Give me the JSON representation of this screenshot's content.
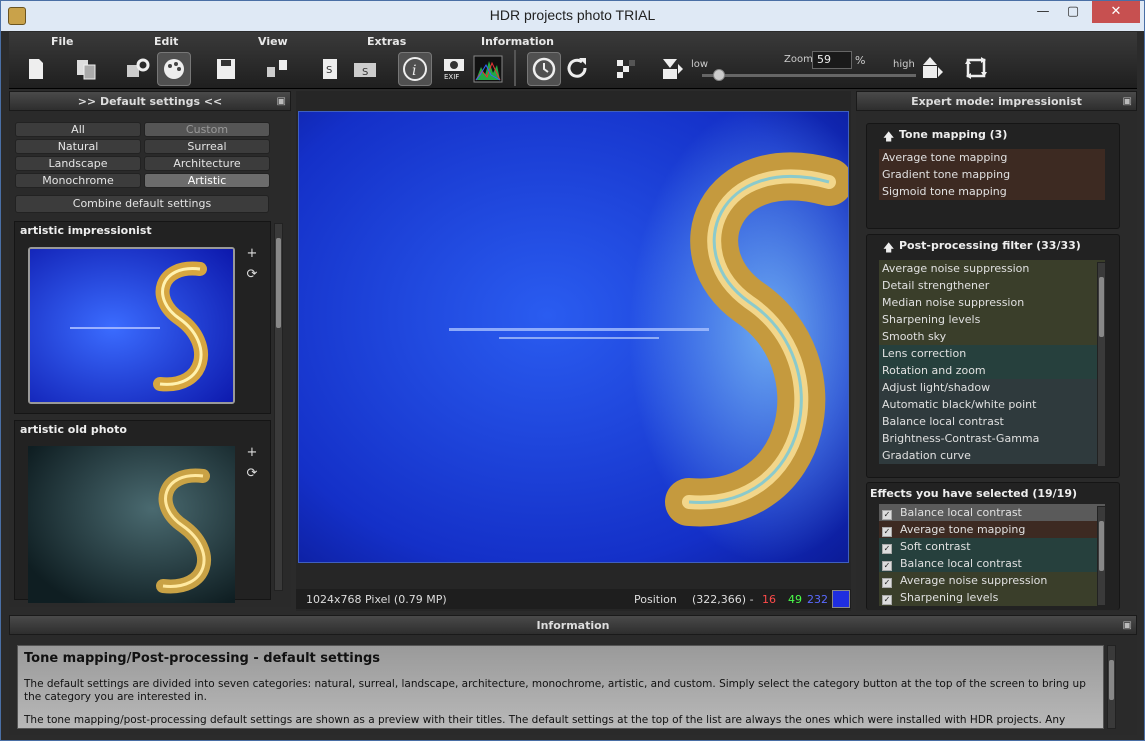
{
  "window": {
    "title": "HDR projects photo  TRIAL",
    "minimize": "—",
    "maximize": "▢",
    "close": "✕"
  },
  "menu": {
    "file": "File",
    "edit": "Edit",
    "view": "View",
    "extras": "Extras",
    "information": "Information"
  },
  "zoom": {
    "label": "Zoom",
    "value": "59",
    "unit": "%",
    "low": "low",
    "high": "high",
    "level": 0.05
  },
  "left_panel": {
    "header": ">> Default settings <<",
    "categories": [
      "All",
      "Custom",
      "Natural",
      "Surreal",
      "Landscape",
      "Architecture",
      "Monochrome",
      "Artistic"
    ],
    "combine": "Combine default settings",
    "presets": [
      {
        "title": "artistic impressionist"
      },
      {
        "title": "artistic old photo"
      }
    ]
  },
  "center": {
    "status_size": "1024x768 Pixel (0.79 MP)",
    "position_label": "Position",
    "position_value": "(322,366) -",
    "r": "16",
    "g": "49",
    "b": "232",
    "swatch_color": "#1f2ee0"
  },
  "right_panel": {
    "header": "Expert mode: impressionist",
    "tone_mapping": {
      "title": "Tone mapping (3)",
      "items": [
        "Average tone mapping",
        "Gradient tone mapping",
        "Sigmoid tone mapping"
      ]
    },
    "post_processing": {
      "title": "Post-processing filter (33/33)",
      "items": [
        "Average noise suppression",
        "Detail strengthener",
        "Median noise suppression",
        "Sharpening levels",
        "Smooth sky",
        "Lens correction",
        "Rotation and zoom",
        "Adjust light/shadow",
        "Automatic black/white point",
        "Balance local contrast",
        "Brightness-Contrast-Gamma",
        "Gradation curve"
      ]
    },
    "selected": {
      "title": "Effects you have selected (19/19)",
      "items": [
        "Balance local contrast",
        "Average tone mapping",
        "Soft contrast",
        "Balance local contrast",
        "Average noise suppression",
        "Sharpening levels"
      ]
    }
  },
  "info": {
    "header": "Information",
    "heading": "Tone mapping/Post-processing - default settings",
    "p1": "The default settings are divided into seven categories: natural, surreal, landscape, architecture, monochrome, artistic, and custom. Simply select the category button at the top of the screen to bring up the category you are interested in.",
    "p2": "The tone mapping/post-processing default settings are shown as a preview with their titles. The default settings at the top of the list are always the ones which were installed with HDR projects. Any default settings you"
  }
}
